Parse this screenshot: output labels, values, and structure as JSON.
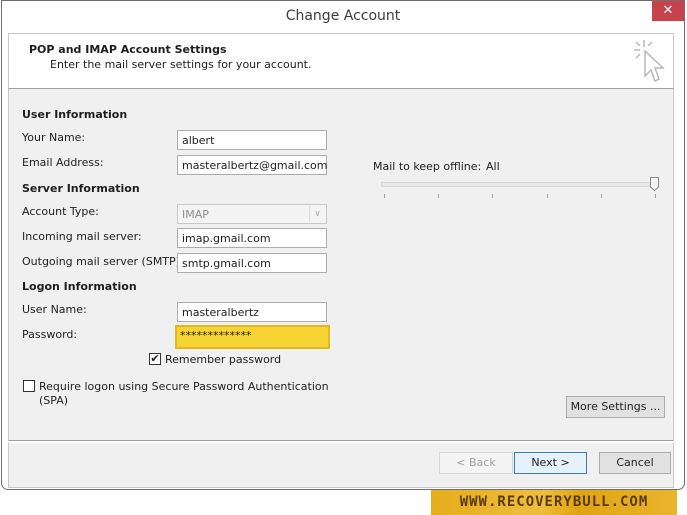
{
  "window": {
    "title": "Change Account",
    "close_icon": "close-icon"
  },
  "header": {
    "title": "POP and IMAP Account Settings",
    "subtitle": "Enter the mail server settings for your account.",
    "icon": "cursor-click-icon"
  },
  "user_info": {
    "section_label": "User Information",
    "your_name_label": "Your Name:",
    "your_name_value": "albert",
    "email_label": "Email Address:",
    "email_value": "masteralbertz@gmail.com"
  },
  "server_info": {
    "section_label": "Server Information",
    "account_type_label": "Account Type:",
    "account_type_value": "IMAP",
    "incoming_label": "Incoming mail server:",
    "incoming_value": "imap.gmail.com",
    "outgoing_label": "Outgoing mail server (SMTP):",
    "outgoing_value": "smtp.gmail.com"
  },
  "logon_info": {
    "section_label": "Logon Information",
    "user_name_label": "User Name:",
    "user_name_value": "masteralbertz",
    "password_label": "Password:",
    "password_value": "*************",
    "remember_password_label": "Remember password",
    "remember_password_checked": true,
    "spa_label_line1": "Require logon using Secure Password Authentication",
    "spa_label_line2": "(SPA)",
    "spa_checked": false
  },
  "offline": {
    "label": "Mail to keep offline:",
    "value": "All",
    "slider_position": "6 of 6 (max)",
    "tick_count": 6
  },
  "buttons": {
    "more_settings": "More Settings ...",
    "back": "< Back",
    "next": "Next >",
    "cancel": "Cancel"
  },
  "watermark": {
    "text": "WWW.RECOVERYBULL.COM"
  }
}
